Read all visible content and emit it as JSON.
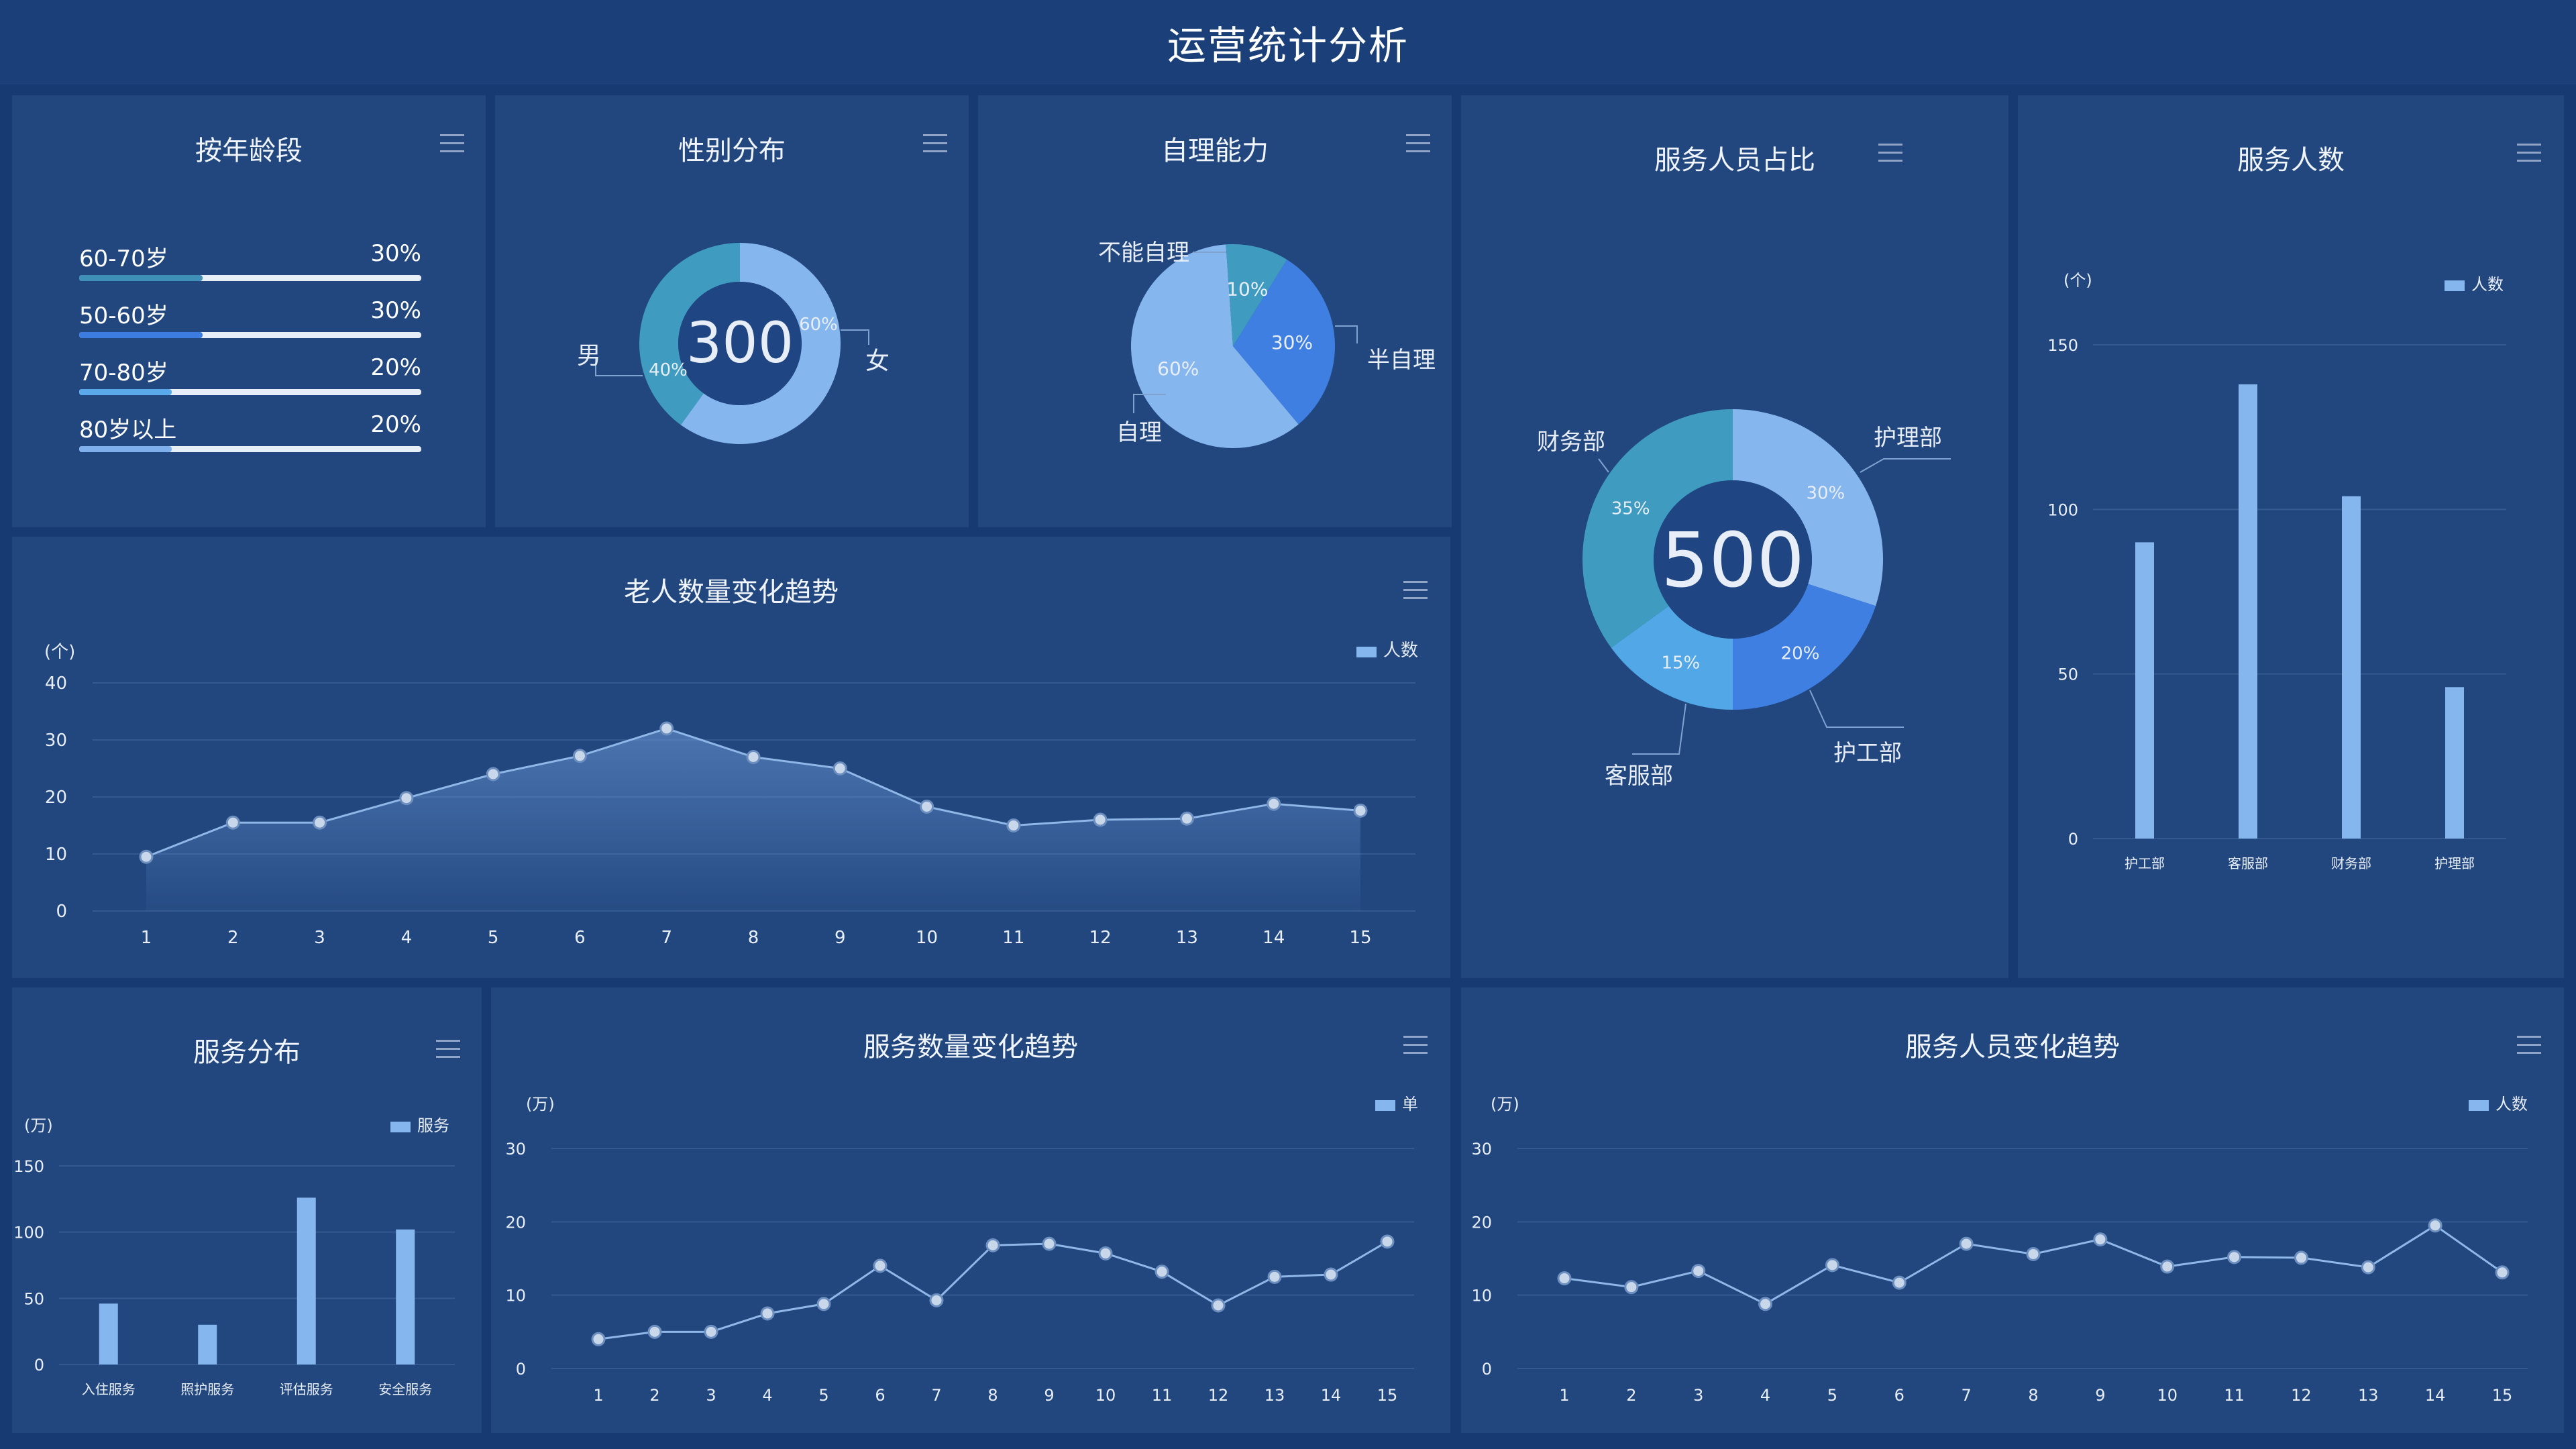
{
  "page": {
    "title": "运营统计分析"
  },
  "age": {
    "title": "按年龄段",
    "rows": [
      {
        "label": "60-70岁",
        "pct": "30%",
        "value": 0.36,
        "color": "#3f8fb6"
      },
      {
        "label": "50-60岁",
        "pct": "30%",
        "value": 0.36,
        "color": "#3c7be0"
      },
      {
        "label": "70-80岁",
        "pct": "20%",
        "value": 0.27,
        "color": "#5aa9ea"
      },
      {
        "label": "80岁以上",
        "pct": "20%",
        "value": 0.27,
        "color": "#7fb0ec"
      }
    ]
  },
  "gender": {
    "title": "性别分布",
    "center": "300",
    "male_label": "男",
    "female_label": "女",
    "slices": [
      {
        "name": "女",
        "label": "60%",
        "value": 60,
        "color": "#86b6ee"
      },
      {
        "name": "男",
        "label": "40%",
        "value": 40,
        "color": "#3f9cc0"
      }
    ]
  },
  "selfcare": {
    "title": "自理能力",
    "slices": [
      {
        "name": "半自理",
        "label": "60%",
        "value": 60,
        "color": "#86b6ee"
      },
      {
        "name": "自理",
        "label": "10%",
        "value": 10,
        "color": "#3f9cc0"
      },
      {
        "name": "不能自理",
        "label": "30%",
        "value": 30,
        "color": "#3f7fe2"
      }
    ]
  },
  "staff_ratio": {
    "title": "服务人员占比",
    "center": "500",
    "slices": [
      {
        "name": "护理部",
        "label": "30%",
        "value": 30,
        "color": "#86b6ee"
      },
      {
        "name": "护工部",
        "label": "20%",
        "value": 20,
        "color": "#3f7fe2"
      },
      {
        "name": "客服部",
        "label": "15%",
        "value": 15,
        "color": "#52a8e6"
      },
      {
        "name": "财务部",
        "label": "35%",
        "value": 35,
        "color": "#3f9cc0"
      }
    ]
  },
  "staff_count": {
    "title": "服务人数",
    "unit": "(个)",
    "legend": "人数",
    "categories": [
      "护工部",
      "客服部",
      "财务部",
      "护理部"
    ],
    "values": [
      90,
      138,
      104,
      46
    ],
    "yticks": [
      "0",
      "50",
      "100",
      "150"
    ],
    "ymax": 150
  },
  "elder_trend": {
    "title": "老人数量变化趋势",
    "unit": "(个)",
    "legend": "人数",
    "x": [
      "1",
      "2",
      "3",
      "4",
      "5",
      "6",
      "7",
      "8",
      "9",
      "10",
      "11",
      "12",
      "13",
      "14",
      "15"
    ],
    "values": [
      9.5,
      15.5,
      15.5,
      19.8,
      24,
      27.2,
      32,
      27,
      25,
      18.3,
      15,
      16,
      16.2,
      18.8,
      17.6
    ],
    "yticks": [
      "0",
      "10",
      "20",
      "30",
      "40"
    ],
    "ymax": 40
  },
  "service_dist": {
    "title": "服务分布",
    "unit": "(万)",
    "legend": "服务",
    "categories": [
      "入住服务",
      "照护服务",
      "评估服务",
      "安全服务"
    ],
    "values": [
      46,
      30,
      126,
      102
    ],
    "yticks": [
      "0",
      "50",
      "100",
      "150"
    ],
    "ymax": 150
  },
  "service_trend": {
    "title": "服务数量变化趋势",
    "unit": "(万)",
    "legend": "单",
    "x": [
      "1",
      "2",
      "3",
      "4",
      "5",
      "6",
      "7",
      "8",
      "9",
      "10",
      "11",
      "12",
      "13",
      "14",
      "15"
    ],
    "values": [
      4,
      5,
      5,
      7.5,
      8.8,
      14,
      9.3,
      16.8,
      17,
      15.7,
      13.2,
      8.6,
      12.5,
      12.8,
      17.3
    ],
    "yticks": [
      "0",
      "10",
      "20",
      "30"
    ],
    "ymax": 30
  },
  "staff_trend": {
    "title": "服务人员变化趋势",
    "unit": "(万)",
    "legend": "人数",
    "x": [
      "1",
      "2",
      "3",
      "4",
      "5",
      "6",
      "7",
      "8",
      "9",
      "10",
      "11",
      "12",
      "13",
      "14",
      "15"
    ],
    "values": [
      12.3,
      11.1,
      13.3,
      8.8,
      14.1,
      11.7,
      17,
      15.6,
      17.6,
      13.9,
      15.2,
      15.1,
      13.8,
      19.5,
      13.1
    ],
    "yticks": [
      "0",
      "10",
      "20",
      "30"
    ],
    "ymax": 30
  },
  "chart_data": [
    {
      "type": "bar",
      "title": "按年龄段",
      "categories": [
        "60-70岁",
        "50-60岁",
        "70-80岁",
        "80岁以上"
      ],
      "values": [
        30,
        30,
        20,
        20
      ]
    },
    {
      "type": "pie",
      "title": "性别分布",
      "categories": [
        "女",
        "男"
      ],
      "values": [
        60,
        40
      ]
    },
    {
      "type": "pie",
      "title": "自理能力",
      "categories": [
        "半自理",
        "自理",
        "不能自理"
      ],
      "values": [
        60,
        10,
        30
      ]
    },
    {
      "type": "pie",
      "title": "服务人员占比",
      "categories": [
        "护理部",
        "护工部",
        "客服部",
        "财务部"
      ],
      "values": [
        30,
        20,
        15,
        35
      ]
    },
    {
      "type": "bar",
      "title": "服务人数",
      "categories": [
        "护工部",
        "客服部",
        "财务部",
        "护理部"
      ],
      "values": [
        90,
        138,
        104,
        46
      ],
      "ylabel": "(个)",
      "ylim": [
        0,
        150
      ]
    },
    {
      "type": "area",
      "title": "老人数量变化趋势",
      "x": [
        1,
        2,
        3,
        4,
        5,
        6,
        7,
        8,
        9,
        10,
        11,
        12,
        13,
        14,
        15
      ],
      "series": [
        {
          "name": "人数",
          "values": [
            9.5,
            15.5,
            15.5,
            19.8,
            24,
            27.2,
            32,
            27,
            25,
            18.3,
            15,
            16,
            16.2,
            18.8,
            17.6
          ]
        }
      ],
      "ylabel": "(个)",
      "ylim": [
        0,
        40
      ]
    },
    {
      "type": "bar",
      "title": "服务分布",
      "categories": [
        "入住服务",
        "照护服务",
        "评估服务",
        "安全服务"
      ],
      "values": [
        46,
        30,
        126,
        102
      ],
      "ylabel": "(万)",
      "ylim": [
        0,
        150
      ]
    },
    {
      "type": "line",
      "title": "服务数量变化趋势",
      "x": [
        1,
        2,
        3,
        4,
        5,
        6,
        7,
        8,
        9,
        10,
        11,
        12,
        13,
        14,
        15
      ],
      "series": [
        {
          "name": "单",
          "values": [
            4,
            5,
            5,
            7.5,
            8.8,
            14,
            9.3,
            16.8,
            17,
            15.7,
            13.2,
            8.6,
            12.5,
            12.8,
            17.3
          ]
        }
      ],
      "ylabel": "(万)",
      "ylim": [
        0,
        30
      ]
    },
    {
      "type": "line",
      "title": "服务人员变化趋势",
      "x": [
        1,
        2,
        3,
        4,
        5,
        6,
        7,
        8,
        9,
        10,
        11,
        12,
        13,
        14,
        15
      ],
      "series": [
        {
          "name": "人数",
          "values": [
            12.3,
            11.1,
            13.3,
            8.8,
            14.1,
            11.7,
            17,
            15.6,
            17.6,
            13.9,
            15.2,
            15.1,
            13.8,
            19.5,
            13.1
          ]
        }
      ],
      "ylabel": "(万)",
      "ylim": [
        0,
        30
      ]
    }
  ]
}
